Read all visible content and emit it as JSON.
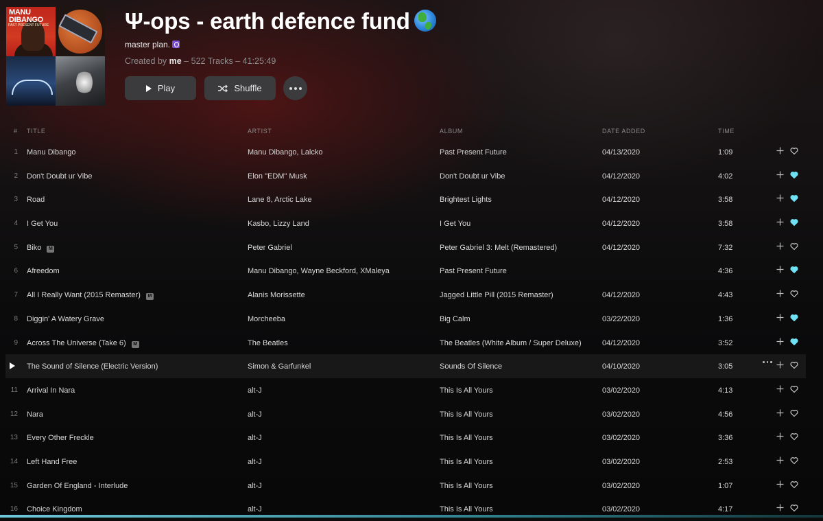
{
  "header": {
    "title": "Ψ-ops - earth defence fund",
    "subtitle": "master plan.",
    "meta_prefix": "Created by",
    "owner": "me",
    "meta_suffix": " – 522 Tracks – 41:25:49",
    "cover_text": "MANU DIBANGO",
    "cover_sub": "PAST PRESENT FUTURE",
    "play_label": "Play",
    "shuffle_label": "Shuffle"
  },
  "columns": {
    "num": "#",
    "title": "TITLE",
    "artist": "ARTIST",
    "album": "ALBUM",
    "date": "DATE ADDED",
    "time": "TIME"
  },
  "colors": {
    "accent_heart": "#6fe3f5",
    "heart_outline": "#c8c8c8"
  },
  "tracks": [
    {
      "num": "1",
      "title": "Manu Dibango",
      "badge": "",
      "artist": "Manu Dibango, Lalcko",
      "album": "Past Present Future",
      "date": "04/13/2020",
      "time": "1:09",
      "liked": false,
      "selected": false
    },
    {
      "num": "2",
      "title": "Don't Doubt ur Vibe",
      "badge": "",
      "artist": "Elon \"EDM\" Musk",
      "album": "Don't Doubt ur Vibe",
      "date": "04/12/2020",
      "time": "4:02",
      "liked": true,
      "selected": false
    },
    {
      "num": "3",
      "title": "Road",
      "badge": "",
      "artist": "Lane 8, Arctic Lake",
      "album": "Brightest Lights",
      "date": "04/12/2020",
      "time": "3:58",
      "liked": true,
      "selected": false
    },
    {
      "num": "4",
      "title": "I Get You",
      "badge": "",
      "artist": "Kasbo, Lizzy Land",
      "album": "I Get You",
      "date": "04/12/2020",
      "time": "3:58",
      "liked": true,
      "selected": false
    },
    {
      "num": "5",
      "title": "Biko",
      "badge": "M",
      "artist": "Peter Gabriel",
      "album": "Peter Gabriel 3: Melt (Remastered)",
      "date": "04/12/2020",
      "time": "7:32",
      "liked": false,
      "selected": false
    },
    {
      "num": "6",
      "title": "Afreedom",
      "badge": "",
      "artist": "Manu Dibango, Wayne Beckford, XMaleya",
      "album": "Past Present Future",
      "date": "",
      "time": "4:36",
      "liked": true,
      "selected": false
    },
    {
      "num": "7",
      "title": "All I Really Want (2015 Remaster)",
      "badge": "M",
      "artist": "Alanis Morissette",
      "album": "Jagged Little Pill (2015 Remaster)",
      "date": "04/12/2020",
      "time": "4:43",
      "liked": false,
      "selected": false
    },
    {
      "num": "8",
      "title": "Diggin' A Watery Grave",
      "badge": "",
      "artist": "Morcheeba",
      "album": "Big Calm",
      "date": "03/22/2020",
      "time": "1:36",
      "liked": true,
      "selected": false
    },
    {
      "num": "9",
      "title": "Across The Universe (Take 6)",
      "badge": "M",
      "artist": "The Beatles",
      "album": "The Beatles (White Album / Super Deluxe)",
      "date": "04/12/2020",
      "time": "3:52",
      "liked": true,
      "selected": false
    },
    {
      "num": "",
      "title": "The Sound of Silence (Electric Version)",
      "badge": "",
      "artist": "Simon & Garfunkel",
      "album": "Sounds Of Silence",
      "date": "04/10/2020",
      "time": "3:05",
      "liked": false,
      "selected": true
    },
    {
      "num": "11",
      "title": "Arrival In Nara",
      "badge": "",
      "artist": "alt-J",
      "album": "This Is All Yours",
      "date": "03/02/2020",
      "time": "4:13",
      "liked": false,
      "selected": false
    },
    {
      "num": "12",
      "title": "Nara",
      "badge": "",
      "artist": "alt-J",
      "album": "This Is All Yours",
      "date": "03/02/2020",
      "time": "4:56",
      "liked": false,
      "selected": false
    },
    {
      "num": "13",
      "title": "Every Other Freckle",
      "badge": "",
      "artist": "alt-J",
      "album": "This Is All Yours",
      "date": "03/02/2020",
      "time": "3:36",
      "liked": false,
      "selected": false
    },
    {
      "num": "14",
      "title": "Left Hand Free",
      "badge": "",
      "artist": "alt-J",
      "album": "This Is All Yours",
      "date": "03/02/2020",
      "time": "2:53",
      "liked": false,
      "selected": false
    },
    {
      "num": "15",
      "title": "Garden Of England - Interlude",
      "badge": "",
      "artist": "alt-J",
      "album": "This Is All Yours",
      "date": "03/02/2020",
      "time": "1:07",
      "liked": false,
      "selected": false
    },
    {
      "num": "16",
      "title": "Choice Kingdom",
      "badge": "",
      "artist": "alt-J",
      "album": "This Is All Yours",
      "date": "03/02/2020",
      "time": "4:17",
      "liked": false,
      "selected": false
    }
  ]
}
